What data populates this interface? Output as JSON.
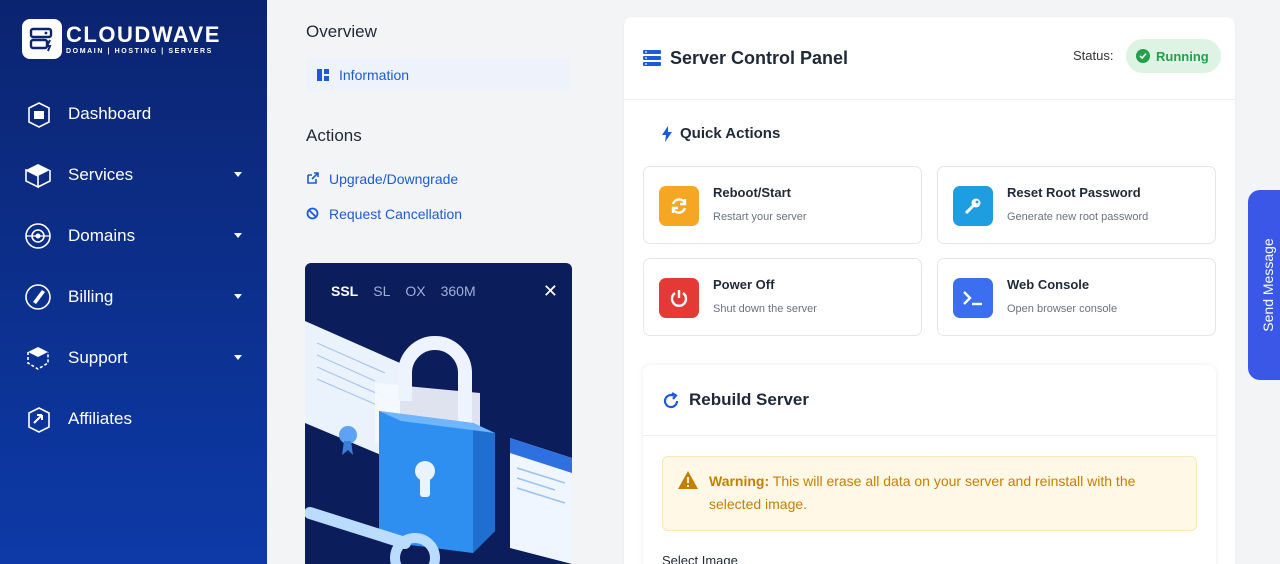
{
  "brand": {
    "name": "CLOUDWAVE",
    "tagline": "DOMAIN | HOSTING | SERVERS"
  },
  "sidebar": {
    "items": [
      {
        "label": "Dashboard",
        "icon": "dashboard-icon",
        "has_caret": false
      },
      {
        "label": "Services",
        "icon": "box-icon",
        "has_caret": true
      },
      {
        "label": "Domains",
        "icon": "globe-icon",
        "has_caret": true
      },
      {
        "label": "Billing",
        "icon": "billing-icon",
        "has_caret": true
      },
      {
        "label": "Support",
        "icon": "support-icon",
        "has_caret": true
      },
      {
        "label": "Affiliates",
        "icon": "affiliates-icon",
        "has_caret": false
      }
    ]
  },
  "overview": {
    "title": "Overview",
    "info_label": "Information"
  },
  "actions": {
    "title": "Actions",
    "upgrade_label": "Upgrade/Downgrade",
    "cancel_label": "Request Cancellation"
  },
  "promo": {
    "tabs": [
      "SSL",
      "SL",
      "OX",
      "360M"
    ],
    "active_tab": "SSL",
    "close": "✕"
  },
  "panel": {
    "title": "Server Control Panel",
    "status_label": "Status:",
    "status_value": "Running",
    "status_color": "#22a04b"
  },
  "quick_actions": {
    "title": "Quick Actions",
    "cards": [
      {
        "title": "Reboot/Start",
        "subtitle": "Restart your server",
        "icon": "refresh-icon",
        "color": "#f5a623"
      },
      {
        "title": "Reset Root Password",
        "subtitle": "Generate new root password",
        "icon": "key-icon",
        "color": "#1e9de0"
      },
      {
        "title": "Power Off",
        "subtitle": "Shut down the server",
        "icon": "power-icon",
        "color": "#e53935"
      },
      {
        "title": "Web Console",
        "subtitle": "Open browser console",
        "icon": "terminal-icon",
        "color": "#3b6ff0"
      }
    ]
  },
  "rebuild": {
    "title": "Rebuild Server",
    "warning_label": "Warning:",
    "warning_text": " This will erase all data on your server and reinstall with the selected image.",
    "select_label": "Select Image"
  },
  "send_message": "Send Message"
}
